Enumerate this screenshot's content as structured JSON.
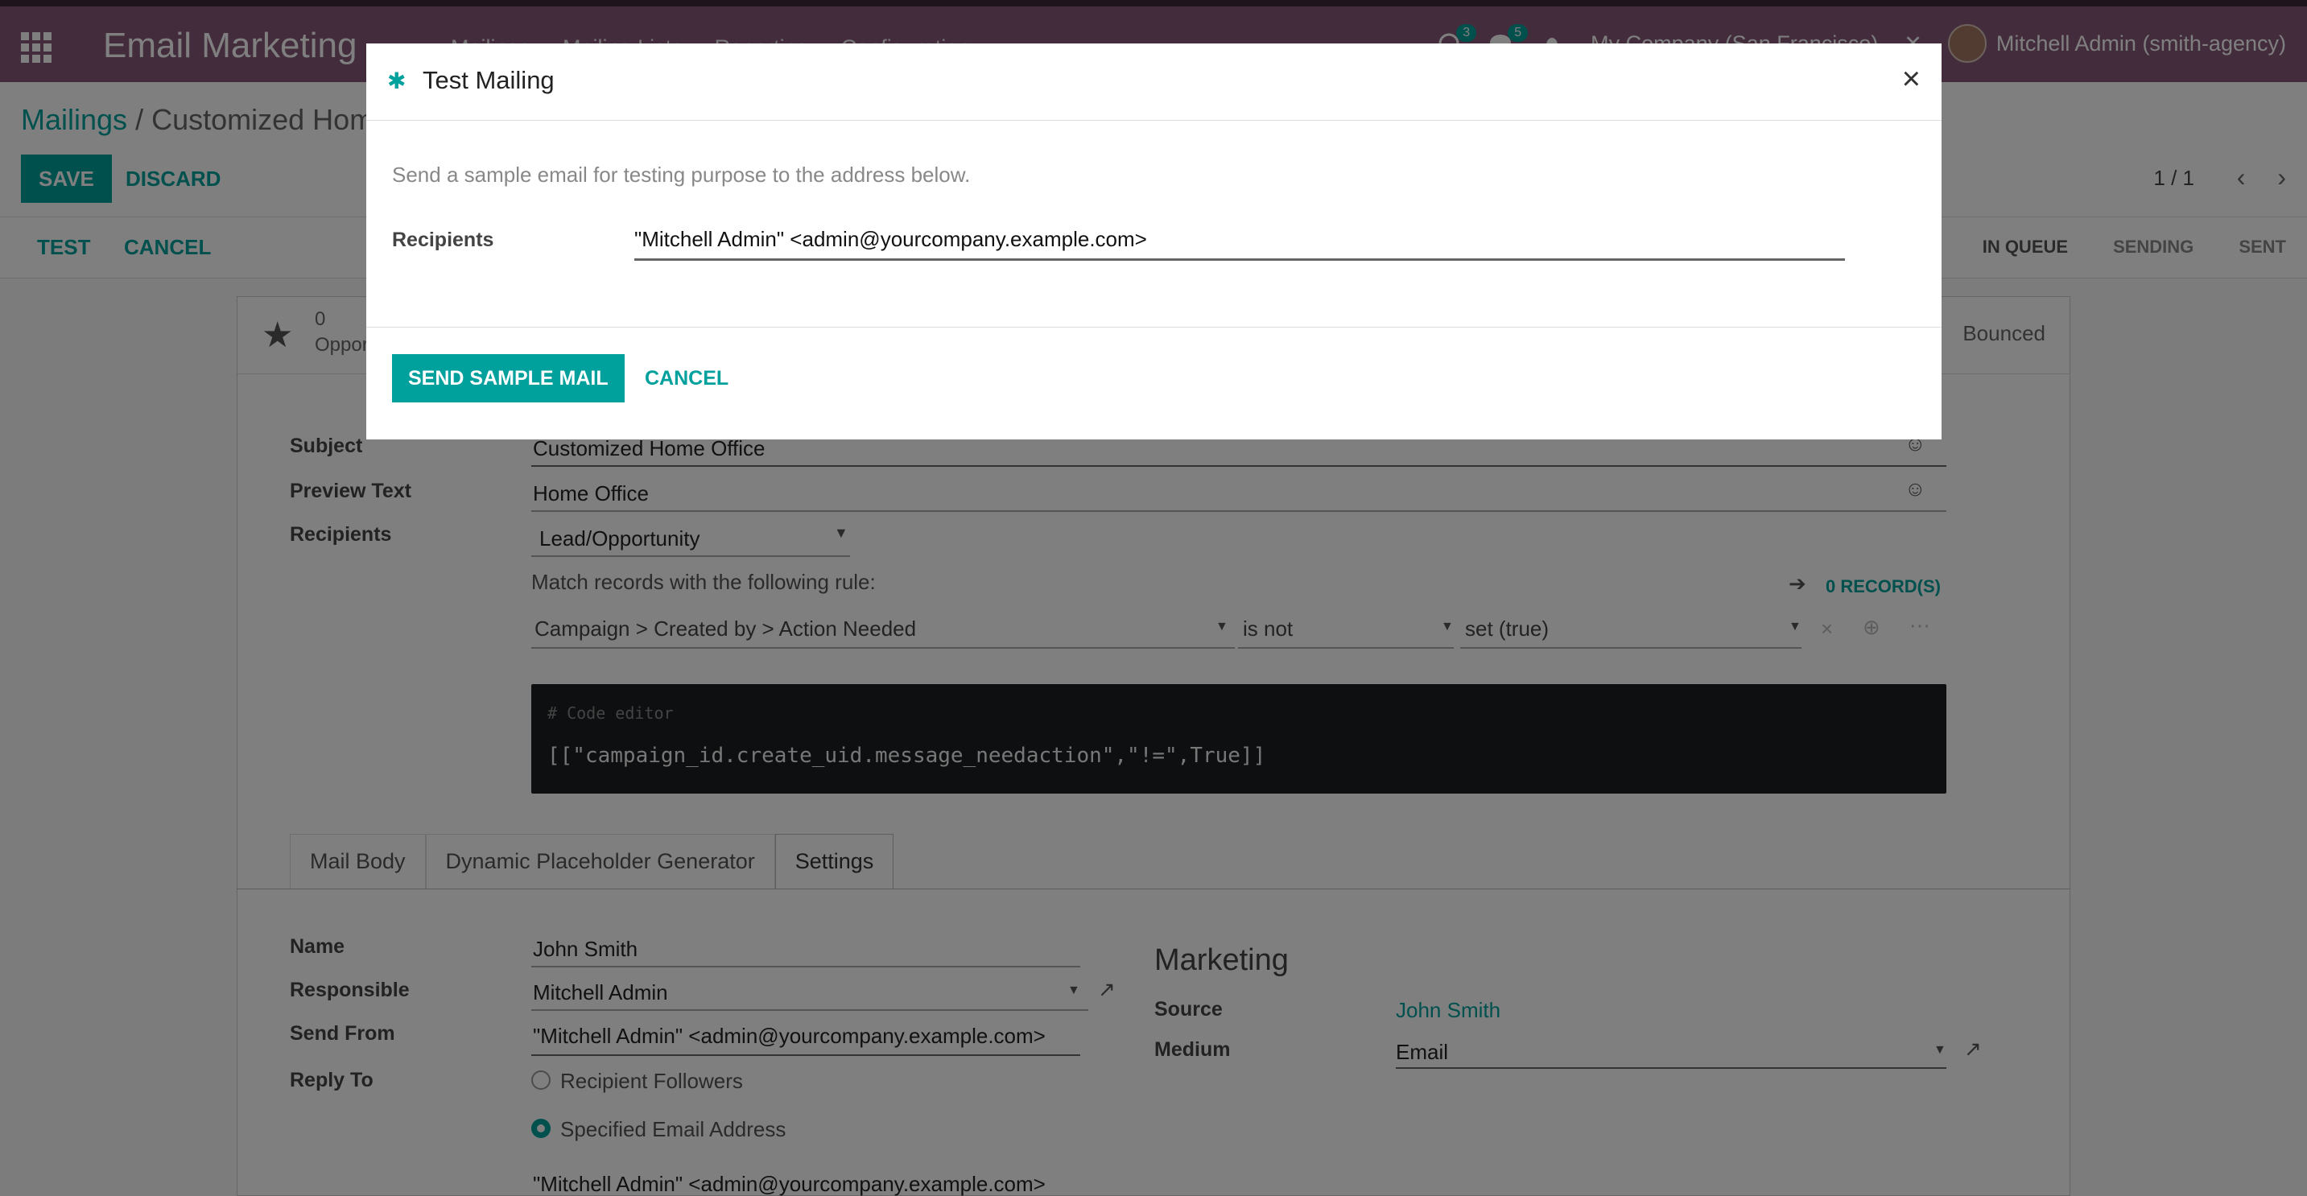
{
  "navbar": {
    "app_title": "Email Marketing",
    "menu": [
      "Mailings",
      "Mailing Lists",
      "Reporting",
      "Configuration"
    ],
    "activity_count": "3",
    "messages_count": "5",
    "company": "My Company (San Francisco)",
    "user": "Mitchell Admin (smith-agency)"
  },
  "control": {
    "breadcrumb_root": "Mailings",
    "breadcrumb_sep": "/",
    "breadcrumb_current": "Customized Home Office",
    "save_label": "SAVE",
    "discard_label": "DISCARD",
    "pager": "1 / 1"
  },
  "statusbar": {
    "test_label": "TEST",
    "cancel_label": "CANCEL",
    "stages": [
      "IN QUEUE",
      "SENDING",
      "SENT"
    ]
  },
  "stat": {
    "count": "0",
    "label": "Opportunities",
    "bounced": "Bounced"
  },
  "form": {
    "subject_label": "Subject",
    "subject_value": "Customized Home Office",
    "preview_label": "Preview Text",
    "preview_value": "Home Office",
    "recipients_label": "Recipients",
    "recipients_value": "Lead/Opportunity",
    "rule_text": "Match records with the following rule:",
    "records_link": "0 RECORD(S)",
    "domain_path": "Campaign > Created by > Action Needed",
    "domain_op": "is not",
    "domain_val": "set (true)",
    "code_comment": "# Code editor",
    "code_text": "[[\"campaign_id.create_uid.message_needaction\",\"!=\",True]]"
  },
  "tabs": [
    "Mail Body",
    "Dynamic Placeholder Generator",
    "Settings"
  ],
  "settings": {
    "name_label": "Name",
    "name_value": "John Smith",
    "responsible_label": "Responsible",
    "responsible_value": "Mitchell Admin",
    "send_from_label": "Send From",
    "send_from_value": "\"Mitchell Admin\" <admin@yourcompany.example.com>",
    "reply_to_label": "Reply To",
    "reply_opt1": "Recipient Followers",
    "reply_opt2": "Specified Email Address",
    "reply_value": "\"Mitchell Admin\" <admin@yourcompany.example.com>",
    "marketing_title": "Marketing",
    "source_label": "Source",
    "source_value": "John Smith",
    "medium_label": "Medium",
    "medium_value": "Email"
  },
  "modal": {
    "title": "Test Mailing",
    "description": "Send a sample email for testing purpose to the address below.",
    "recipients_label": "Recipients",
    "recipients_value": "\"Mitchell Admin\" <admin@yourcompany.example.com>",
    "send_label": "SEND SAMPLE MAIL",
    "cancel_label": "CANCEL"
  }
}
